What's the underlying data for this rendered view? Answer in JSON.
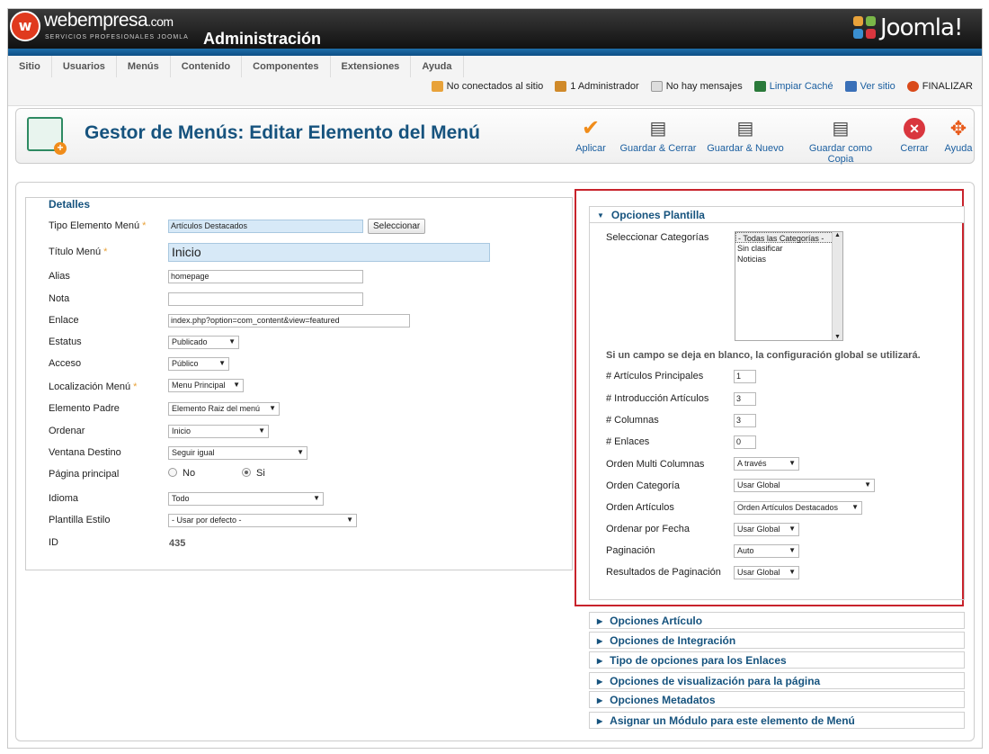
{
  "header": {
    "brand": "webempresa",
    "brand_domain": ".com",
    "tagline": "SERVICIOS PROFESIONALES JOOMLA",
    "title": "Administración",
    "cms_logo_text": "Joomla!"
  },
  "menu": [
    "Sitio",
    "Usuarios",
    "Menús",
    "Contenido",
    "Componentes",
    "Extensiones",
    "Ayuda"
  ],
  "status": {
    "not_connected": "No conectados al sitio",
    "admins": "1 Administrador",
    "messages": "No hay mensajes",
    "clear_cache": "Limpiar Caché",
    "view_site": "Ver sitio",
    "logout": "FINALIZAR"
  },
  "toolbar": {
    "page_title": "Gestor de Menús: Editar Elemento del Menú",
    "apply": "Aplicar",
    "save_close": "Guardar & Cerrar",
    "save_new": "Guardar & Nuevo",
    "save_copy": "Guardar como Copia",
    "close": "Cerrar",
    "help": "Ayuda"
  },
  "details": {
    "legend": "Detalles",
    "menu_type_label": "Tipo Elemento Menú",
    "menu_type_value": "Artículos Destacados",
    "select_button": "Seleccionar",
    "title_label": "Título Menú",
    "title_value": "Inicio",
    "alias_label": "Alias",
    "alias_value": "homepage",
    "note_label": "Nota",
    "note_value": "",
    "link_label": "Enlace",
    "link_value": "index.php?option=com_content&view=featured",
    "status_label": "Estatus",
    "status_value": "Publicado",
    "access_label": "Acceso",
    "access_value": "Público",
    "location_label": "Localización Menú",
    "location_value": "Menu Principal",
    "parent_label": "Elemento Padre",
    "parent_value": "Elemento Raiz del menú",
    "order_label": "Ordenar",
    "order_value": "Inicio",
    "window_label": "Ventana Destino",
    "window_value": "Seguir igual",
    "home_label": "Página principal",
    "home_no": "No",
    "home_yes": "Si",
    "home_selected": "Si",
    "language_label": "Idioma",
    "language_value": "Todo",
    "template_label": "Plantilla Estilo",
    "template_value": "- Usar por defecto -",
    "id_label": "ID",
    "id_value": "435"
  },
  "template_options": {
    "title": "Opciones Plantilla",
    "categories_label": "Seleccionar Categorías",
    "categories": [
      "- Todas las Categorías -",
      "Sin clasificar",
      "Noticias"
    ],
    "hint": "Si un campo se deja en blanco, la configuración global se utilizará.",
    "leading_label": "# Artículos Principales",
    "leading_value": "1",
    "intro_label": "# Introducción Artículos",
    "intro_value": "3",
    "columns_label": "# Columnas",
    "columns_value": "3",
    "links_label": "# Enlaces",
    "links_value": "0",
    "multi_col_label": "Orden Multi Columnas",
    "multi_col_value": "A través",
    "cat_order_label": "Orden Categoría",
    "cat_order_value": "Usar Global",
    "art_order_label": "Orden Artículos",
    "art_order_value": "Orden Artículos Destacados",
    "date_order_label": "Ordenar por Fecha",
    "date_order_value": "Usar Global",
    "pagination_label": "Paginación",
    "pagination_value": "Auto",
    "pag_results_label": "Resultados de Paginación",
    "pag_results_value": "Usar Global"
  },
  "panels": [
    "Opciones Artículo",
    "Opciones de Integración",
    "Tipo de opciones para los Enlaces",
    "Opciones de visualización para la página",
    "Opciones Metadatos",
    "Asignar un Módulo para este elemento de Menú"
  ],
  "colors": {
    "title_blue": "#16537e",
    "header_stripe": "#1e6da8",
    "highlight_border": "#c8232c",
    "required_star": "#e8a23a"
  }
}
